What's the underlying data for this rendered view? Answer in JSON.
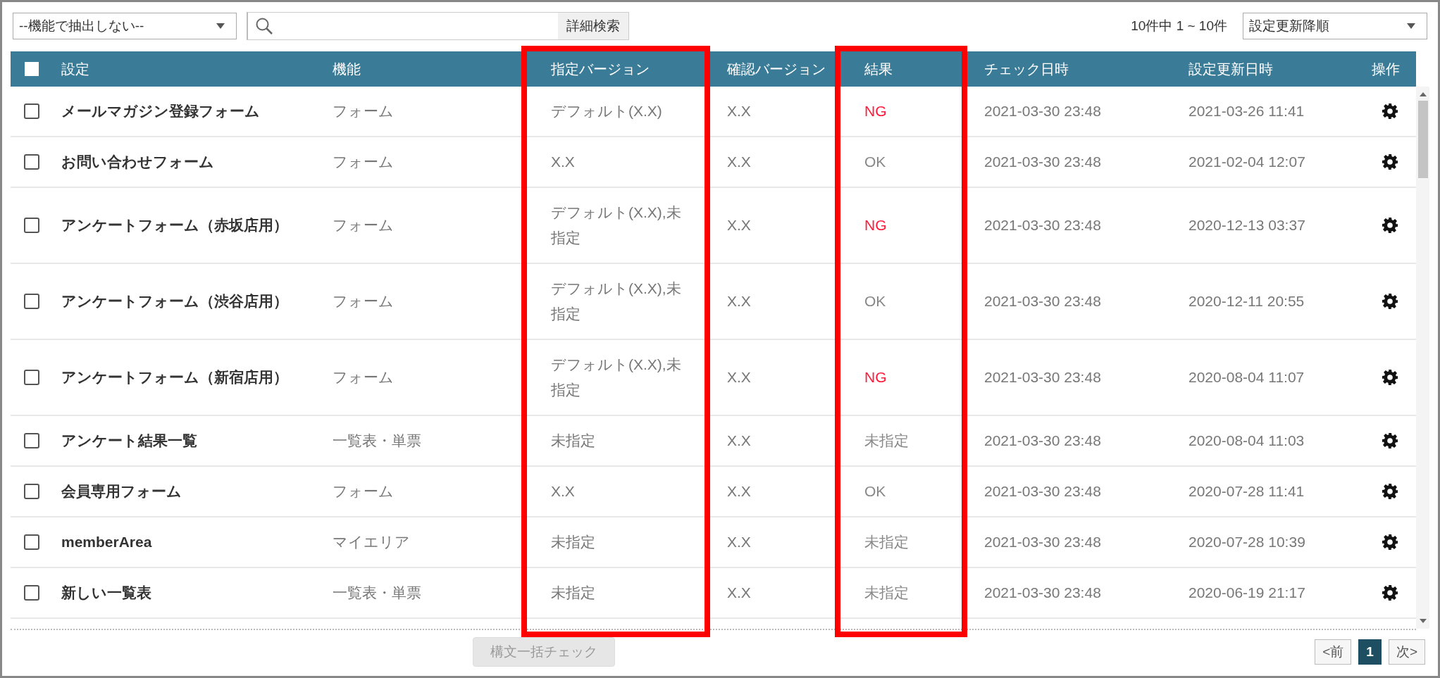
{
  "filter_dropdown": {
    "value": "--機能で抽出しない--"
  },
  "search": {
    "button": "詳細検索"
  },
  "result_count": "10件中 1 ~ 10件",
  "sort_dropdown": {
    "value": "設定更新降順"
  },
  "table": {
    "select_all": {
      "checked": false
    },
    "columns": [
      {
        "label": "設定",
        "highlighted": false
      },
      {
        "label": "機能",
        "highlighted": false
      },
      {
        "label": "指定バージョン",
        "highlighted": true
      },
      {
        "label": "確認バージョン",
        "highlighted": false
      },
      {
        "label": "結果",
        "highlighted": true
      },
      {
        "label": "チェック日時",
        "highlighted": false
      },
      {
        "label": "設定更新日時",
        "highlighted": false
      },
      {
        "label": "操作",
        "highlighted": false
      }
    ],
    "rows": [
      {
        "selected": false,
        "setting": "メールマガジン登録フォーム",
        "function": "フォーム",
        "specified_version": "デフォルト(X.X)",
        "checked_version": "X.X",
        "result": {
          "text": "NG",
          "kind": "ng"
        },
        "check_date": "2021-03-30 23:48",
        "updated": "2021-03-26 11:41"
      },
      {
        "selected": false,
        "setting": "お問い合わせフォーム",
        "function": "フォーム",
        "specified_version": "X.X",
        "checked_version": "X.X",
        "result": {
          "text": "OK",
          "kind": "ok"
        },
        "check_date": "2021-03-30 23:48",
        "updated": "2021-02-04 12:07"
      },
      {
        "selected": false,
        "setting": "アンケートフォーム（赤坂店用）",
        "function": "フォーム",
        "specified_version": "デフォルト(X.X),未指定",
        "checked_version": "X.X",
        "result": {
          "text": "NG",
          "kind": "ng"
        },
        "check_date": "2021-03-30 23:48",
        "updated": "2020-12-13 03:37"
      },
      {
        "selected": false,
        "setting": "アンケートフォーム（渋谷店用）",
        "function": "フォーム",
        "specified_version": "デフォルト(X.X),未指定",
        "checked_version": "X.X",
        "result": {
          "text": "OK",
          "kind": "ok"
        },
        "check_date": "2021-03-30 23:48",
        "updated": "2020-12-11 20:55"
      },
      {
        "selected": false,
        "setting": "アンケートフォーム（新宿店用）",
        "function": "フォーム",
        "specified_version": "デフォルト(X.X),未指定",
        "checked_version": "X.X",
        "result": {
          "text": "NG",
          "kind": "ng"
        },
        "check_date": "2021-03-30 23:48",
        "updated": "2020-08-04 11:07"
      },
      {
        "selected": false,
        "setting": "アンケート結果一覧",
        "function": "一覧表・単票",
        "specified_version": "未指定",
        "checked_version": "X.X",
        "result": {
          "text": "未指定",
          "kind": "unset"
        },
        "check_date": "2021-03-30 23:48",
        "updated": "2020-08-04 11:03"
      },
      {
        "selected": false,
        "setting": "会員専用フォーム",
        "function": "フォーム",
        "specified_version": "X.X",
        "checked_version": "X.X",
        "result": {
          "text": "OK",
          "kind": "ok"
        },
        "check_date": "2021-03-30 23:48",
        "updated": "2020-07-28 11:41"
      },
      {
        "selected": false,
        "setting": "memberArea",
        "function": "マイエリア",
        "specified_version": "未指定",
        "checked_version": "X.X",
        "result": {
          "text": "未指定",
          "kind": "unset"
        },
        "check_date": "2021-03-30 23:48",
        "updated": "2020-07-28 10:39"
      },
      {
        "selected": false,
        "setting": "新しい一覧表",
        "function": "一覧表・単票",
        "specified_version": "未指定",
        "checked_version": "X.X",
        "result": {
          "text": "未指定",
          "kind": "unset"
        },
        "check_date": "2021-03-30 23:48",
        "updated": "2020-06-19 21:17"
      }
    ]
  },
  "bulk_check_button": {
    "label": "構文一括チェック",
    "disabled": true
  },
  "pagination": {
    "prev": "<前",
    "pages": [
      {
        "label": "1",
        "selected": true
      }
    ],
    "next": "次>"
  }
}
